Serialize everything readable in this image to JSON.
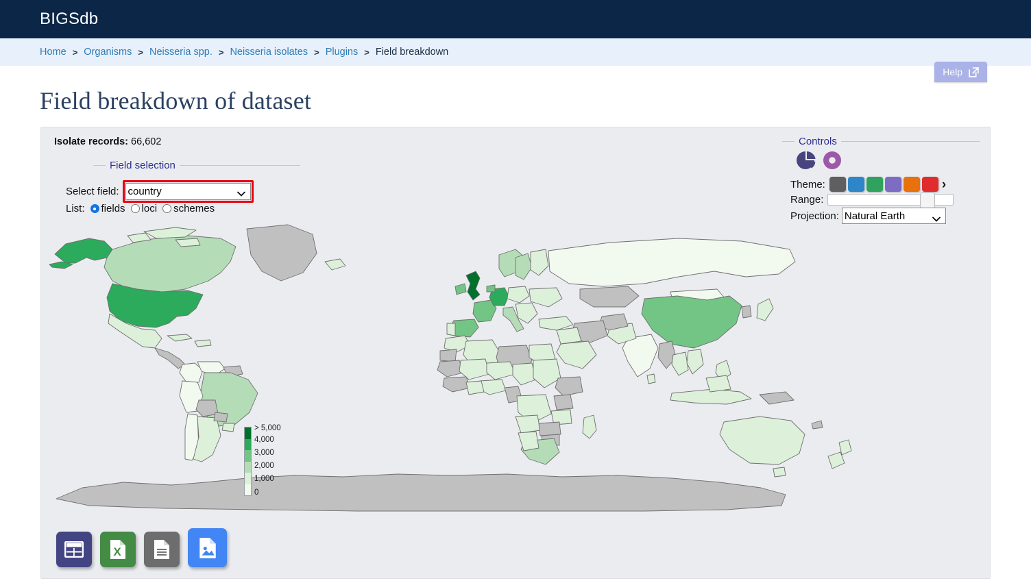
{
  "app": {
    "brand": "BIGSdb",
    "topbar_color": "#0b2647"
  },
  "breadcrumb": {
    "items": [
      {
        "label": "Home",
        "current": false
      },
      {
        "label": "Organisms",
        "current": false
      },
      {
        "label": "Neisseria spp.",
        "current": false
      },
      {
        "label": "Neisseria isolates",
        "current": false
      },
      {
        "label": "Plugins",
        "current": false
      },
      {
        "label": "Field breakdown",
        "current": true
      }
    ],
    "separator": ">"
  },
  "help": {
    "label": "Help",
    "icon": "external-link-icon",
    "color": "#aab2e8"
  },
  "page": {
    "title": "Field breakdown of dataset"
  },
  "records": {
    "label": "Isolate records:",
    "value": "66,602"
  },
  "field_selection": {
    "legend": "Field selection",
    "select_field_label": "Select field:",
    "selected_field": "country",
    "field_options": [
      "country"
    ],
    "highlight_color": "#e8000d",
    "list_label": "List:",
    "list_options": [
      {
        "label": "fields",
        "checked": true
      },
      {
        "label": "loci",
        "checked": false
      },
      {
        "label": "schemes",
        "checked": false
      }
    ]
  },
  "controls": {
    "legend": "Controls",
    "chart_types": [
      {
        "name": "pie-chart-icon",
        "color": "#47447e",
        "selected": false
      },
      {
        "name": "donut-chart-icon",
        "color": "#9b59a8",
        "selected": true
      }
    ],
    "theme_label": "Theme:",
    "theme_swatches": [
      "#5f5f5f",
      "#2e86c8",
      "#2fa35d",
      "#7c6cc4",
      "#e8700d",
      "#e02c2c"
    ],
    "theme_more_icon": "chevron-right-icon",
    "range_label": "Range:",
    "range_value": 73,
    "projection_label": "Projection:",
    "projection_value": "Natural Earth",
    "projection_options": [
      "Natural Earth"
    ]
  },
  "map_legend": {
    "title": "",
    "stops": [
      {
        "label": "> 5,000",
        "color": "#00702c"
      },
      {
        "label": "4,000",
        "color": "#2bab5b"
      },
      {
        "label": "3,000",
        "color": "#73c585"
      },
      {
        "label": "2,000",
        "color": "#b4ddb7"
      },
      {
        "label": "1,000",
        "color": "#dcf0da"
      },
      {
        "label": "0",
        "color": "#f2faf0"
      }
    ]
  },
  "chart_data": {
    "type": "map",
    "title": "Field breakdown of dataset — country",
    "field": "country",
    "total_records": 66602,
    "projection": "Natural Earth",
    "color_scale": [
      "#f2faf0",
      "#dcf0da",
      "#b4ddb7",
      "#73c585",
      "#2bab5b",
      "#00702c"
    ],
    "no_data_color": "#c0c0c0",
    "ocean_color": "#ebecf0",
    "legend_breaks": [
      0,
      1000,
      2000,
      3000,
      4000,
      5000
    ],
    "legend_labels": [
      "0",
      "1,000",
      "2,000",
      "3,000",
      "4,000",
      "> 5,000"
    ],
    "countries": [
      {
        "name": "United Kingdom",
        "bin": "> 5,000",
        "color": "#00702c"
      },
      {
        "name": "United States of America",
        "bin": "4,000",
        "color": "#2bab5b"
      },
      {
        "name": "Alaska (USA)",
        "bin": "4,000",
        "color": "#2bab5b"
      },
      {
        "name": "Germany",
        "bin": "4,000",
        "color": "#2bab5b"
      },
      {
        "name": "France",
        "bin": "3,000",
        "color": "#73c585"
      },
      {
        "name": "Spain",
        "bin": "3,000",
        "color": "#73c585"
      },
      {
        "name": "China",
        "bin": "3,000",
        "color": "#73c585"
      },
      {
        "name": "Ireland",
        "bin": "3,000",
        "color": "#73c585"
      },
      {
        "name": "Netherlands",
        "bin": "3,000",
        "color": "#73c585"
      },
      {
        "name": "Canada",
        "bin": "2,000",
        "color": "#b4ddb7"
      },
      {
        "name": "Brazil",
        "bin": "2,000",
        "color": "#b4ddb7"
      },
      {
        "name": "Norway",
        "bin": "2,000",
        "color": "#b4ddb7"
      },
      {
        "name": "Sweden",
        "bin": "2,000",
        "color": "#b4ddb7"
      },
      {
        "name": "Italy",
        "bin": "2,000",
        "color": "#b4ddb7"
      },
      {
        "name": "South Africa",
        "bin": "2,000",
        "color": "#b4ddb7"
      },
      {
        "name": "Russia",
        "bin": "1,000",
        "color": "#dcf0da"
      },
      {
        "name": "Australia",
        "bin": "1,000",
        "color": "#dcf0da"
      },
      {
        "name": "India",
        "bin": "1,000",
        "color": "#dcf0da"
      },
      {
        "name": "Mexico",
        "bin": "1,000",
        "color": "#dcf0da"
      },
      {
        "name": "Argentina",
        "bin": "1,000",
        "color": "#dcf0da"
      },
      {
        "name": "Greenland",
        "bin": "no data",
        "color": "#c0c0c0"
      },
      {
        "name": "Kazakhstan",
        "bin": "no data",
        "color": "#c0c0c0"
      },
      {
        "name": "Iran",
        "bin": "no data",
        "color": "#c0c0c0"
      },
      {
        "name": "Libya",
        "bin": "no data",
        "color": "#c0c0c0"
      },
      {
        "name": "Antarctica",
        "bin": "no data",
        "color": "#c0c0c0"
      }
    ]
  },
  "export": {
    "buttons": [
      {
        "name": "export-table-button",
        "icon": "table-icon",
        "color": "#434483",
        "label": "Table"
      },
      {
        "name": "export-excel-button",
        "icon": "excel-file-icon",
        "color": "#448b45",
        "label": "Excel"
      },
      {
        "name": "export-text-button",
        "icon": "text-file-icon",
        "color": "#6d6d6d",
        "label": "Text"
      },
      {
        "name": "export-image-button",
        "icon": "image-file-icon",
        "color": "#4285f4",
        "label": "Image"
      }
    ]
  }
}
